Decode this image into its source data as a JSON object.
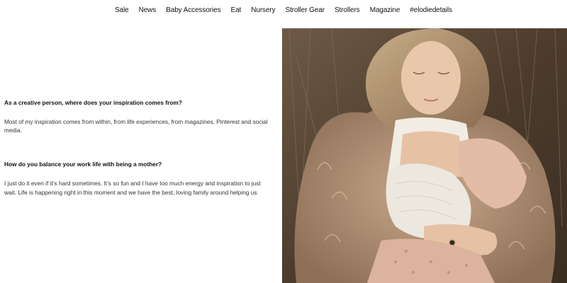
{
  "nav": {
    "items": [
      "Sale",
      "News",
      "Baby Accessories",
      "Eat",
      "Nursery",
      "Stroller Gear",
      "Strollers",
      "Magazine",
      "#elodiedetails"
    ]
  },
  "article": {
    "qa": [
      {
        "question": "As a creative person, where does your inspiration comes from?",
        "answer": "Most of my inspiration comes from within, from life experiences, from magazines, Pinterest and social media."
      },
      {
        "question": "How do you balance your work life with being a mother?",
        "answer": "I just do it even if it’s hard sometimes. It’s so fun and I have too much energy and inspiration to just wait. Life is happening right in this moment and we have the best, loving family around helping us."
      }
    ]
  },
  "photo": {
    "subject": "mother-breastfeeding-baby-photo"
  }
}
